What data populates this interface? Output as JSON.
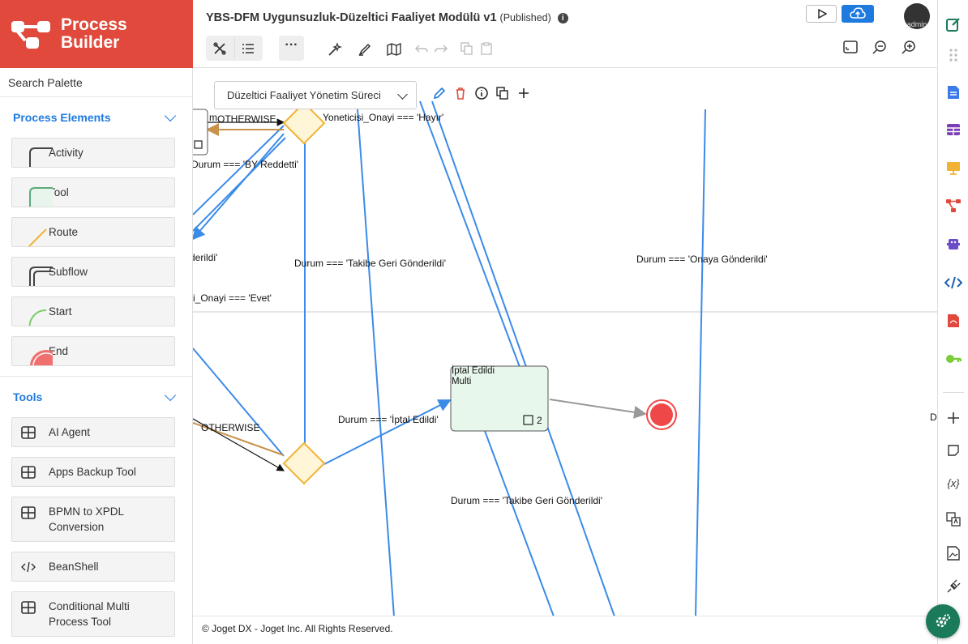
{
  "brand": {
    "title_line1": "Process",
    "title_line2": "Builder"
  },
  "palette": {
    "search_label": "Search Palette",
    "process_elements": {
      "title": "Process Elements",
      "items": [
        {
          "label": "Activity",
          "icon": "activity-shape-icon"
        },
        {
          "label": "Tool",
          "icon": "tool-shape-icon"
        },
        {
          "label": "Route",
          "icon": "route-shape-icon"
        },
        {
          "label": "Subflow",
          "icon": "subflow-shape-icon"
        },
        {
          "label": "Start",
          "icon": "start-shape-icon"
        },
        {
          "label": "End",
          "icon": "end-shape-icon"
        }
      ]
    },
    "tools": {
      "title": "Tools",
      "items": [
        {
          "label": "AI Agent",
          "icon": "grid-icon"
        },
        {
          "label": "Apps Backup Tool",
          "icon": "grid-icon"
        },
        {
          "label": "BPMN to XPDL Conversion",
          "icon": "grid-icon"
        },
        {
          "label": "BeanShell",
          "icon": "code-icon"
        },
        {
          "label": "Conditional Multi Process Tool",
          "icon": "grid-icon"
        }
      ]
    }
  },
  "header": {
    "title": "YBS-DFM Uygunsuzluk-Düzeltici Faaliyet Modülü v1",
    "status": "(Published)",
    "avatar_label": "admin"
  },
  "canvas": {
    "lane_select_value": "Düzeltici Faaliyet Yönetim Süreci",
    "labels": {
      "l1": "OTHERWISE",
      "l2": "m",
      "l3": "Yoneticisi_Onayi === 'Hayır'",
      "l4": "Durum === 'BY Reddetti'",
      "l5": "derildi'",
      "l6": "Durum === 'Takibe Geri Gönderildi'",
      "l7": "Durum === 'Onaya Gönderildi'",
      "l8": "i_Onayi === 'Evet'",
      "l9": "OTHERWISE",
      "l10": "Durum === 'İptal Edildi'",
      "l11": "Durum === 'Takibe Geri Gönderildi'",
      "l12": "D"
    },
    "activity": {
      "title": "İptal Edildi",
      "subtitle": "Multi",
      "count": "2"
    }
  },
  "footer": {
    "text": "© Joget DX - Joget Inc. All Rights Reserved."
  },
  "colors": {
    "brand": "#e0493b",
    "accent": "#1f7ae0",
    "gateway": "#f2b233",
    "end": "#f04848",
    "fab": "#1a7a5a"
  }
}
